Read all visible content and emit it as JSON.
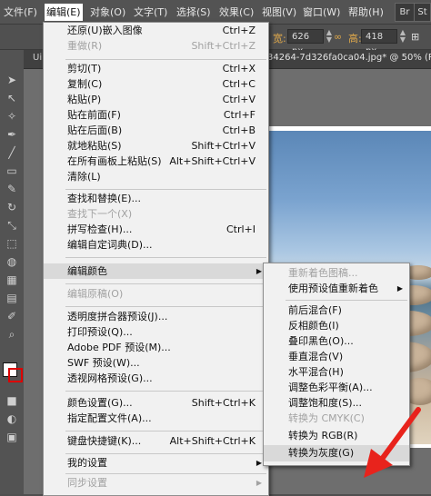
{
  "menubar": {
    "items": [
      "文件(F)",
      "编辑(E)",
      "对象(O)",
      "文字(T)",
      "选择(S)",
      "效果(C)",
      "视图(V)",
      "窗口(W)",
      "帮助(H)"
    ],
    "right_buttons": [
      "Br",
      "St"
    ]
  },
  "controlbar": {
    "w_label": "宽:",
    "w_value": "626 px",
    "h_label": "高:",
    "h_value": "418 px"
  },
  "doc_tab": {
    "left_text": "Ui",
    "title": "34264-7d326fa0ca04.jpg* @ 50% (RGB"
  },
  "edit_menu": {
    "items": [
      {
        "label": "还原(U)嵌入图像",
        "shortcut": "Ctrl+Z",
        "disabled": false
      },
      {
        "label": "重做(R)",
        "shortcut": "Shift+Ctrl+Z",
        "disabled": true
      },
      {
        "label": "剪切(T)",
        "shortcut": "Ctrl+X",
        "disabled": false
      },
      {
        "label": "复制(C)",
        "shortcut": "Ctrl+C",
        "disabled": false
      },
      {
        "label": "粘贴(P)",
        "shortcut": "Ctrl+V",
        "disabled": false
      },
      {
        "label": "贴在前面(F)",
        "shortcut": "Ctrl+F",
        "disabled": false
      },
      {
        "label": "贴在后面(B)",
        "shortcut": "Ctrl+B",
        "disabled": false
      },
      {
        "label": "就地粘贴(S)",
        "shortcut": "Shift+Ctrl+V",
        "disabled": false
      },
      {
        "label": "在所有画板上粘贴(S)",
        "shortcut": "Alt+Shift+Ctrl+V",
        "disabled": false
      },
      {
        "label": "清除(L)",
        "shortcut": "",
        "disabled": false
      },
      {
        "label": "查找和替换(E)...",
        "shortcut": "",
        "disabled": false
      },
      {
        "label": "查找下一个(X)",
        "shortcut": "",
        "disabled": true
      },
      {
        "label": "拼写检查(H)...",
        "shortcut": "Ctrl+I",
        "disabled": false
      },
      {
        "label": "编辑自定词典(D)...",
        "shortcut": "",
        "disabled": false
      },
      {
        "label": "编辑颜色",
        "shortcut": "",
        "disabled": false,
        "submenu": true,
        "highlighted": true
      },
      {
        "label": "编辑原稿(O)",
        "shortcut": "",
        "disabled": true
      },
      {
        "label": "透明度拼合器预设(J)...",
        "shortcut": "",
        "disabled": false
      },
      {
        "label": "打印预设(Q)...",
        "shortcut": "",
        "disabled": false
      },
      {
        "label": "Adobe PDF 预设(M)...",
        "shortcut": "",
        "disabled": false
      },
      {
        "label": "SWF 预设(W)...",
        "shortcut": "",
        "disabled": false
      },
      {
        "label": "透视网格预设(G)...",
        "shortcut": "",
        "disabled": false
      },
      {
        "label": "颜色设置(G)...",
        "shortcut": "Shift+Ctrl+K",
        "disabled": false
      },
      {
        "label": "指定配置文件(A)...",
        "shortcut": "",
        "disabled": false
      },
      {
        "label": "键盘快捷键(K)...",
        "shortcut": "Alt+Shift+Ctrl+K",
        "disabled": false
      },
      {
        "label": "我的设置",
        "shortcut": "",
        "disabled": false,
        "submenu": true
      },
      {
        "label": "同步设置",
        "shortcut": "",
        "disabled": true,
        "submenu": true
      }
    ]
  },
  "color_submenu": {
    "items": [
      {
        "label": "重新着色图稿...",
        "disabled": true
      },
      {
        "label": "使用预设值重新着色",
        "disabled": false,
        "submenu": true
      },
      {
        "label": "前后混合(F)",
        "disabled": false
      },
      {
        "label": "反相颜色(I)",
        "disabled": false
      },
      {
        "label": "叠印黑色(O)...",
        "disabled": false
      },
      {
        "label": "垂直混合(V)",
        "disabled": false
      },
      {
        "label": "水平混合(H)",
        "disabled": false
      },
      {
        "label": "调整色彩平衡(A)...",
        "disabled": false
      },
      {
        "label": "调整饱和度(S)...",
        "disabled": false
      },
      {
        "label": "转换为 CMYK(C)",
        "disabled": true
      },
      {
        "label": "转换为 RGB(R)",
        "disabled": false
      },
      {
        "label": "转换为灰度(G)",
        "disabled": false,
        "highlighted": true
      }
    ]
  },
  "colors": {
    "annotation_arrow": "#e8231c",
    "menu_bg": "#f1f1f1",
    "app_bg": "#535353"
  }
}
